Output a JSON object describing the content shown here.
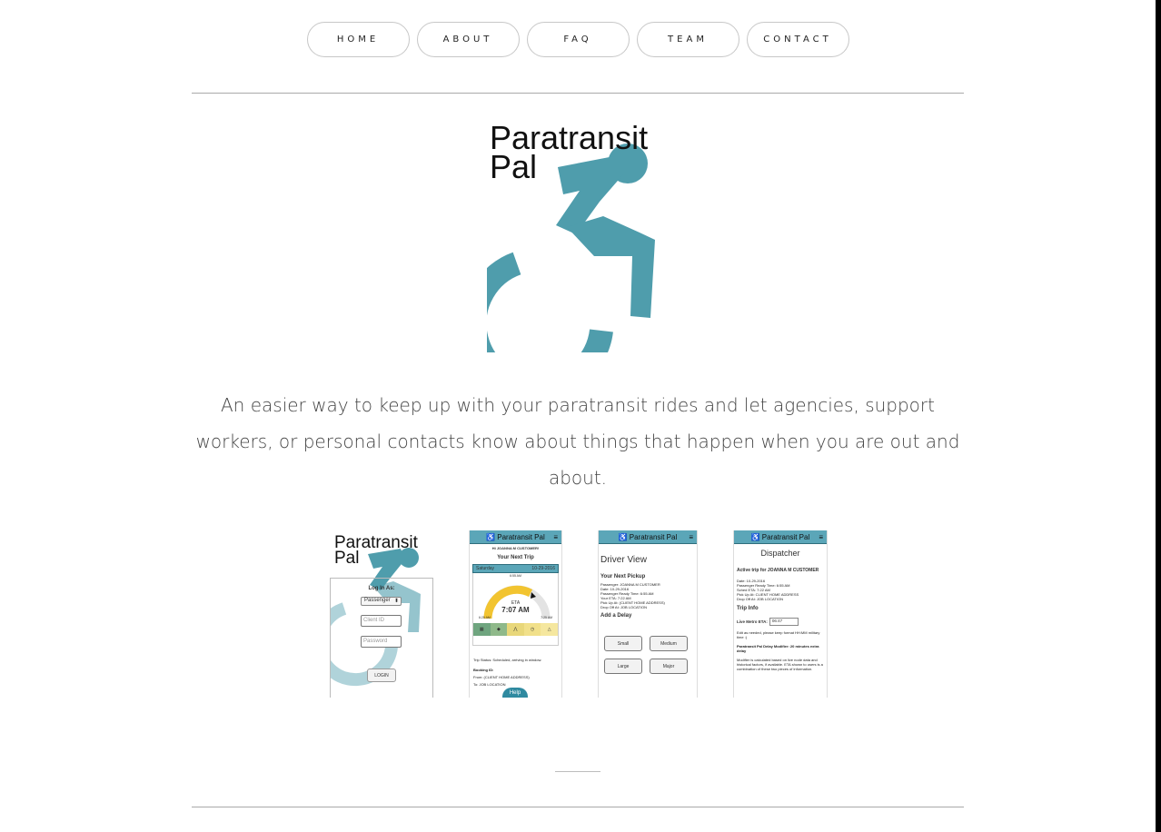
{
  "nav": {
    "items": [
      "HOME",
      "ABOUT",
      "FAQ",
      "TEAM",
      "CONTACT"
    ]
  },
  "logo": {
    "line1": "Paratransit",
    "line2": "Pal",
    "icon": "accessible-wheelchair-icon",
    "color": "#4f9dac"
  },
  "tagline": "An easier way to keep up with your paratransit rides and let agencies, support workers, or personal contacts know about things that happen when you are out and about.",
  "screenshots": {
    "login": {
      "title_line1": "Paratransit",
      "title_line2": "Pal",
      "log_in_as": "Log In As:",
      "role": "Passenger",
      "client_id_placeholder": "Client ID",
      "password_placeholder": "Password",
      "login_button": "LOGIN"
    },
    "passenger": {
      "header": "Paratransit Pal",
      "greeting": "Hi JOANNA M CUSTOMER!",
      "next_trip": "Your Next Trip",
      "day": "Saturday",
      "date": "10-29-2016",
      "gauge_top": "6:55 AM",
      "eta_label": "ETA",
      "eta_time": "7:07 AM",
      "gauge_left": "6:25 AM",
      "gauge_right": "7:25 AM",
      "status": "Trip Status: Scheduled, arriving in window.",
      "booking": "Booking ID:",
      "from": "From: (CLIENT HOME ADDRESS)",
      "to": "To: JOB LOCATION",
      "help": "Help"
    },
    "driver": {
      "header": "Paratransit Pal",
      "title": "Driver View",
      "next_pickup": "Your Next Pickup",
      "details": [
        "Passenger: JOANNA M CUSTOMER",
        "Date: 10-29-2016",
        "Passenger Ready Time: 6:55 AM",
        "Your ETA: 7:22 AM",
        "Pick Up At: (CLIENT HOME ADDRESS)",
        "Drop Off At: JOB LOCATION"
      ],
      "add_delay": "Add a Delay",
      "buttons": [
        "Small",
        "Medium",
        "Large",
        "Major"
      ]
    },
    "dispatcher": {
      "header": "Paratransit Pal",
      "title": "Dispatcher",
      "active": "Active trip for JOANNA M CUSTOMER",
      "details": [
        "Date: 10-29-2016",
        "Passenger Ready Time: 6:55 AM",
        "Sched ETA: 7:22 AM",
        "Pick Up At: CLIENT HOME ADDRESS",
        "Drop Off At: JOB LOCATION"
      ],
      "trip_info": "Trip Info",
      "eta_label": "Live Metro ETA:",
      "eta_value": "06:47",
      "edit_note": "Edit as needed, please keep format HH:MM military time :)",
      "delay_mod": "Paratransit Pal Delay Modifier: 20 minutes extra delay",
      "modifier_note": "Modifier is calculated based on live node data and historical factors, if available. ETA shown to users is a combination of these two pieces of information."
    }
  }
}
